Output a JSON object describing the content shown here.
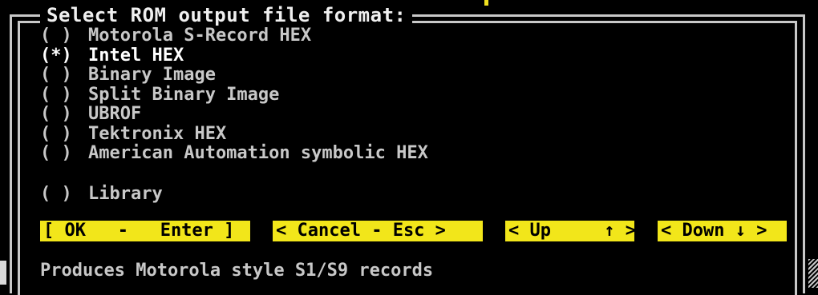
{
  "dialog": {
    "title": "Select ROM output file format:"
  },
  "options": [
    {
      "radio": "( )",
      "label": "Motorola S-Record HEX",
      "selected": false
    },
    {
      "radio": "(*)",
      "label": "Intel HEX",
      "selected": true
    },
    {
      "radio": "( )",
      "label": "Binary Image",
      "selected": false
    },
    {
      "radio": "( )",
      "label": "Split Binary Image",
      "selected": false
    },
    {
      "radio": "( )",
      "label": "UBROF",
      "selected": false
    },
    {
      "radio": "( )",
      "label": "Tektronix HEX",
      "selected": false
    },
    {
      "radio": "( )",
      "label": "American Automation symbolic HEX",
      "selected": false
    },
    {
      "radio": "( )",
      "label": "Library",
      "selected": false
    }
  ],
  "buttons": {
    "ok": "[ OK   -   Enter ]",
    "cancel": "< Cancel - Esc >",
    "up": "< Up     ↑ >",
    "down": "< Down ↓ >"
  },
  "status": {
    "hint": "Produces Motorola style S1/S9 records"
  },
  "colors": {
    "background": "#000000",
    "text": "#c8c8c8",
    "highlight_text": "#ffffff",
    "button_bg": "#f2e61a",
    "button_text": "#000000"
  }
}
